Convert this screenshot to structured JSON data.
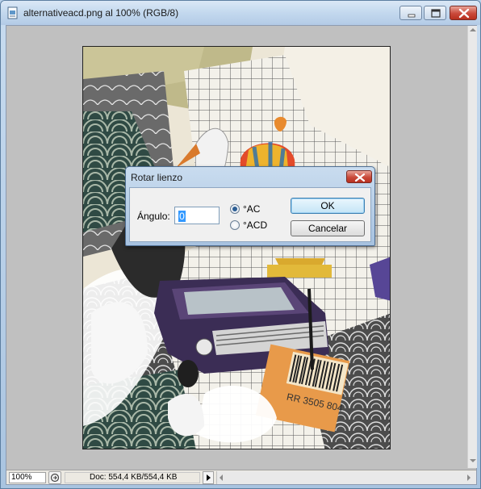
{
  "window": {
    "title": "alternativeacd.png al 100% (RGB/8)"
  },
  "status": {
    "zoom": "100%",
    "doc_info": "Doc: 554,4 KB/554,4 KB"
  },
  "dialog": {
    "title": "Rotar lienzo",
    "angle_label": "Ángulo:",
    "angle_value": "0",
    "radio_ac_label": "°AC",
    "radio_acd_label": "°ACD",
    "selected_direction": "AC",
    "ok_label": "OK",
    "cancel_label": "Cancelar"
  },
  "colors": {
    "client_background": "#c0c0c0",
    "close_button": "#c9493a",
    "default_button_border": "#3c7fb1"
  },
  "icons": [
    "document-icon",
    "minimize-icon",
    "maximize-icon",
    "close-icon",
    "scroll-up-arrow-icon",
    "scroll-down-arrow-icon",
    "scroll-left-arrow-icon",
    "scroll-right-arrow-icon",
    "status-menu-icon",
    "play-arrow-icon"
  ]
}
